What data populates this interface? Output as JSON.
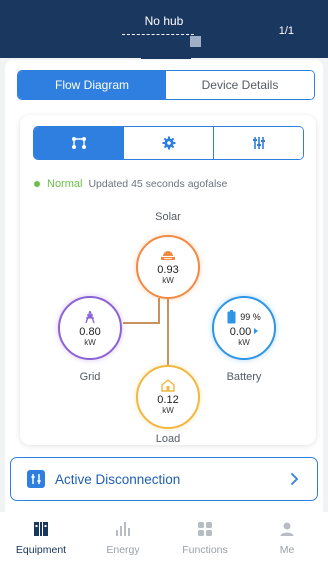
{
  "header": {
    "title": "No hub",
    "page_count": "1/1"
  },
  "tabs": [
    {
      "label": "Flow Diagram",
      "active": true
    },
    {
      "label": "Device Details",
      "active": false
    }
  ],
  "icon_tabs": [
    {
      "icon": "flow-icon",
      "active": true
    },
    {
      "icon": "gear-icon",
      "active": false
    },
    {
      "icon": "sliders-icon",
      "active": false
    }
  ],
  "status": {
    "state": "Normal",
    "updated": "Updated 45 seconds agofalse",
    "color": "#6cc04a"
  },
  "flow": {
    "solar": {
      "label": "Solar",
      "value": "0.93",
      "unit": "kW"
    },
    "grid": {
      "label": "Grid",
      "value": "0.80",
      "unit": "kW"
    },
    "battery": {
      "label": "Battery",
      "value": "0.00",
      "unit": "kW",
      "soc": "99 %"
    },
    "load": {
      "label": "Load",
      "value": "0.12",
      "unit": "kW"
    }
  },
  "active_disconnection": {
    "label": "Active Disconnection"
  },
  "nav": [
    {
      "label": "Equipment",
      "icon": "equipment-icon",
      "active": true
    },
    {
      "label": "Energy",
      "icon": "bar-chart-icon",
      "active": false
    },
    {
      "label": "Functions",
      "icon": "grid-icon",
      "active": false
    },
    {
      "label": "Me",
      "icon": "person-icon",
      "active": false
    }
  ],
  "colors": {
    "header": "#1a3760",
    "accent": "#2f7fe0",
    "solar": "#f08a44",
    "grid": "#8c63d6",
    "battery": "#2f95e6",
    "load": "#f2b740"
  }
}
